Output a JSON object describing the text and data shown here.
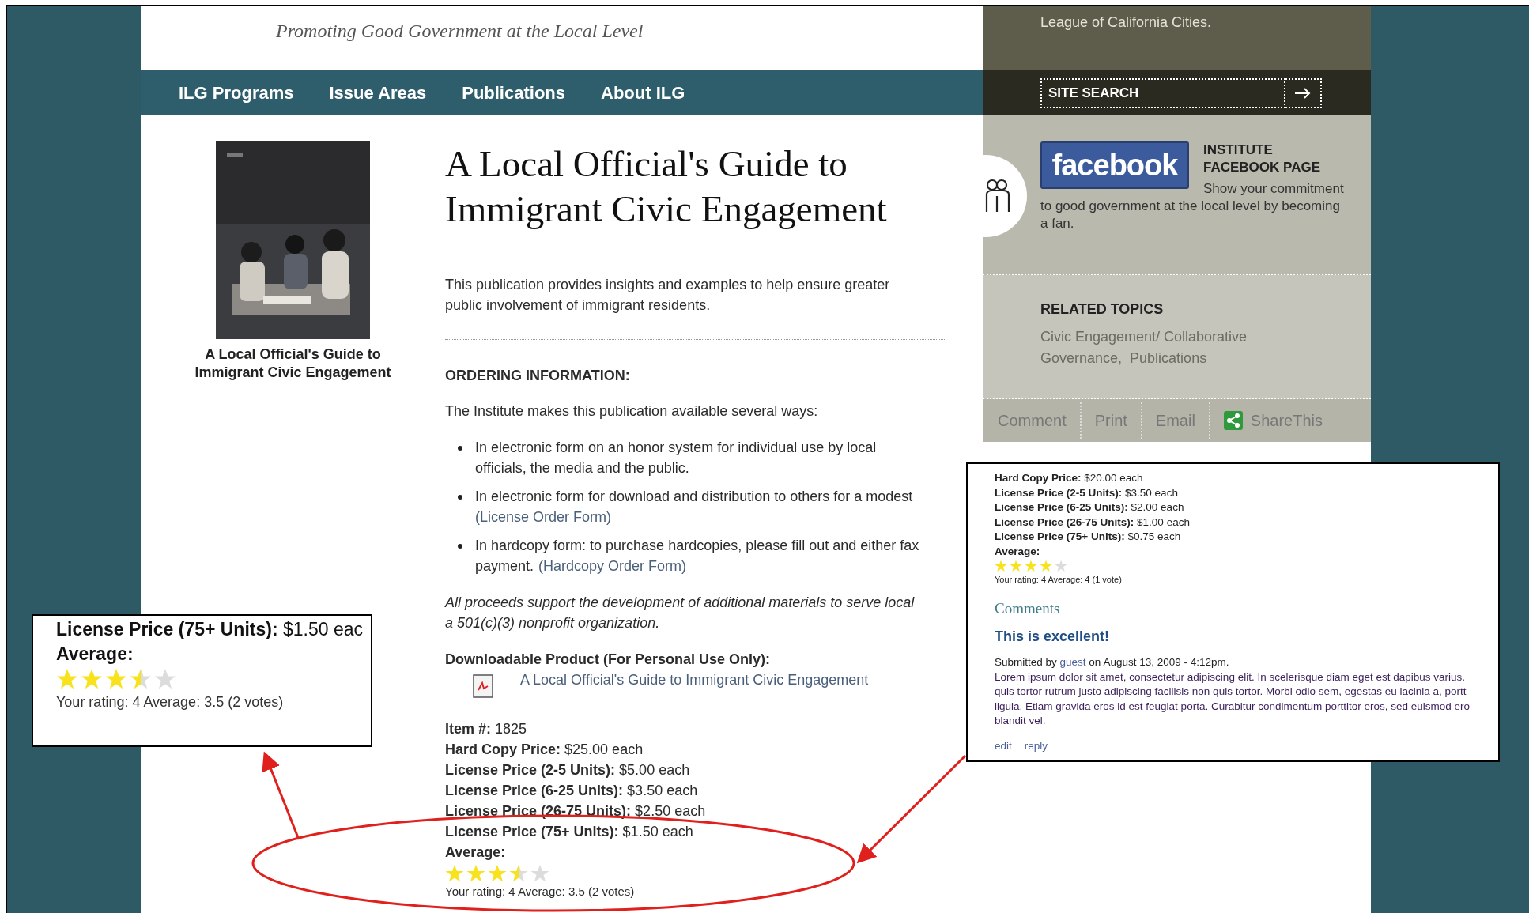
{
  "header": {
    "tagline": "Promoting Good Government at the Local Level",
    "league": "League of California Cities."
  },
  "nav": [
    {
      "label": "ILG Programs"
    },
    {
      "label": "Issue Areas"
    },
    {
      "label": "Publications"
    },
    {
      "label": "About ILG"
    }
  ],
  "search": {
    "placeholder": "SITE SEARCH"
  },
  "book": {
    "caption": "A Local Official's Guide to Immigrant Civic Engagement"
  },
  "article": {
    "title_lines": [
      "A Local Official's Guide to",
      "Immigrant Civic Engagement"
    ],
    "description": "This publication provides insights and examples to help ensure greater public involvement of immigrant residents.",
    "ordering_heading": "ORDERING INFORMATION:",
    "intro": "The Institute makes this publication available several ways:",
    "bullets": [
      {
        "lines": [
          {
            "text": "In electronic form on an honor system for individual use by local"
          },
          {
            "text": "officials, the media and the public."
          }
        ]
      },
      {
        "lines": [
          {
            "text": "In electronic form for download and distribution to others for a modest"
          },
          {
            "link": "(License Order Form)"
          }
        ]
      },
      {
        "lines": [
          {
            "text": "In hardcopy form: to purchase hardcopies, please fill out and either fax"
          },
          {
            "text": "payment.",
            "link": "(Hardcopy Order Form)"
          }
        ]
      }
    ],
    "note_lines": [
      "All proceeds support the development of additional materials to serve local",
      "a 501(c)(3) nonprofit organization."
    ],
    "download_heading": "Downloadable Product (For Personal Use Only):",
    "download_link": "A Local Official's Guide to Immigrant Civic Engagement",
    "details": [
      {
        "label": "Item #:",
        "value": "1825"
      },
      {
        "label": "Hard Copy Price:",
        "value": "$25.00 each"
      },
      {
        "label": "License Price (2-5 Units):",
        "value": "$5.00 each"
      },
      {
        "label": "License Price (6-25 Units):",
        "value": "$3.50 each"
      },
      {
        "label": "License Price (26-75 Units):",
        "value": "$2.50 each"
      },
      {
        "label": "License Price (75+ Units):",
        "value": "$1.50 each"
      }
    ],
    "average_label": "Average:",
    "stars": 3.5,
    "rating": "Your rating: 4 Average: 3.5 (2 votes)"
  },
  "sidebar": {
    "facebook": {
      "logo": "facebook",
      "title": "INSTITUTE FACEBOOK PAGE",
      "text": "Show your commitment to good government at the local level by becoming a fan."
    },
    "related": {
      "heading": "RELATED TOPICS",
      "topics": [
        "Civic Engagement/ Collaborative Governance,",
        "Publications"
      ]
    },
    "actions": [
      {
        "kind": "text",
        "label": "Comment"
      },
      {
        "kind": "text",
        "label": "Print"
      },
      {
        "kind": "text",
        "label": "Email"
      },
      {
        "kind": "share",
        "label": "ShareThis"
      }
    ]
  },
  "callout_left": {
    "price": {
      "label": "License Price (75+ Units):",
      "value": "$1.50 eac"
    },
    "average_label": "Average:",
    "stars": 3.5,
    "rating": "Your rating: 4 Average: 3.5 (2 votes)"
  },
  "callout_right": {
    "details": [
      {
        "label": "Hard Copy Price:",
        "value": "$20.00 each"
      },
      {
        "label": "License Price (2-5 Units):",
        "value": "$3.50 each"
      },
      {
        "label": "License Price (6-25 Units):",
        "value": "$2.00 each"
      },
      {
        "label": "License Price (26-75 Units):",
        "value": "$1.00 each"
      },
      {
        "label": "License Price (75+ Units):",
        "value": "$0.75 each"
      }
    ],
    "average_label": "Average:",
    "stars": 4,
    "rating": "Your rating: 4 Average: 4 (1 vote)",
    "comments_heading": "Comments",
    "comment": {
      "title": "This is excellent!",
      "submitted_prefix": "Submitted by",
      "author": "guest",
      "submitted_suffix": "on August 13, 2009 - 4:12pm.",
      "body_lines": [
        "Lorem ipsum dolor sit amet, consectetur adipiscing elit. In scelerisque diam eget est dapibus varius.",
        "quis tortor rutrum justo adipiscing facilisis non quis tortor. Morbi odio sem, egestas eu lacinia a, portt",
        "ligula. Etiam gravida eros id est feugiat porta. Curabitur condimentum porttitor eros, sed euismod ero",
        "blandit vel."
      ],
      "links": [
        "edit",
        "reply"
      ]
    }
  }
}
